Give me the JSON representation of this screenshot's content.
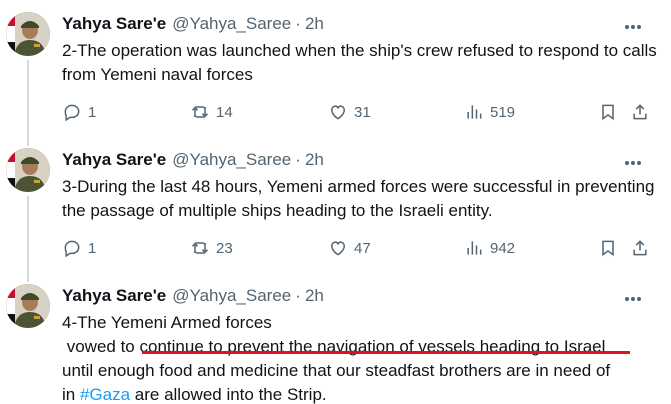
{
  "tweets": [
    {
      "name": "Yahya Sare'e",
      "handle": "@Yahya_Saree",
      "separator": "·",
      "time": "2h",
      "text": "2-The operation was launched when the ship's crew refused to respond to calls from Yemeni naval forces",
      "replies": "1",
      "retweets": "14",
      "likes": "31",
      "views": "519"
    },
    {
      "name": "Yahya Sare'e",
      "handle": "@Yahya_Saree",
      "separator": "·",
      "time": "2h",
      "text": "3-During the last 48 hours, Yemeni armed forces were successful in preventing the passage of multiple ships heading to the Israeli entity.",
      "replies": "1",
      "retweets": "23",
      "likes": "47",
      "views": "942"
    },
    {
      "name": "Yahya Sare'e",
      "handle": "@Yahya_Saree",
      "separator": "·",
      "time": "2h",
      "text_line1": "4-The Yemeni Armed forces",
      "text_line2_pre": " vowed to ",
      "text_line2_highlight": "continue to prevent the navigation of vessels heading to Israel",
      "text_line3": "until enough food and medicine that our steadfast brothers are in need of",
      "text_line4_pre": "in ",
      "hashtag": "#Gaza",
      "text_line4_post": " are allowed into the Strip."
    }
  ],
  "colors": {
    "accent": "#1d9bf0",
    "muted": "#536471",
    "highlight_underline": "#dd1122"
  },
  "icons": [
    "more-icon",
    "reply-icon",
    "retweet-icon",
    "like-icon",
    "views-icon",
    "bookmark-icon",
    "share-icon"
  ]
}
